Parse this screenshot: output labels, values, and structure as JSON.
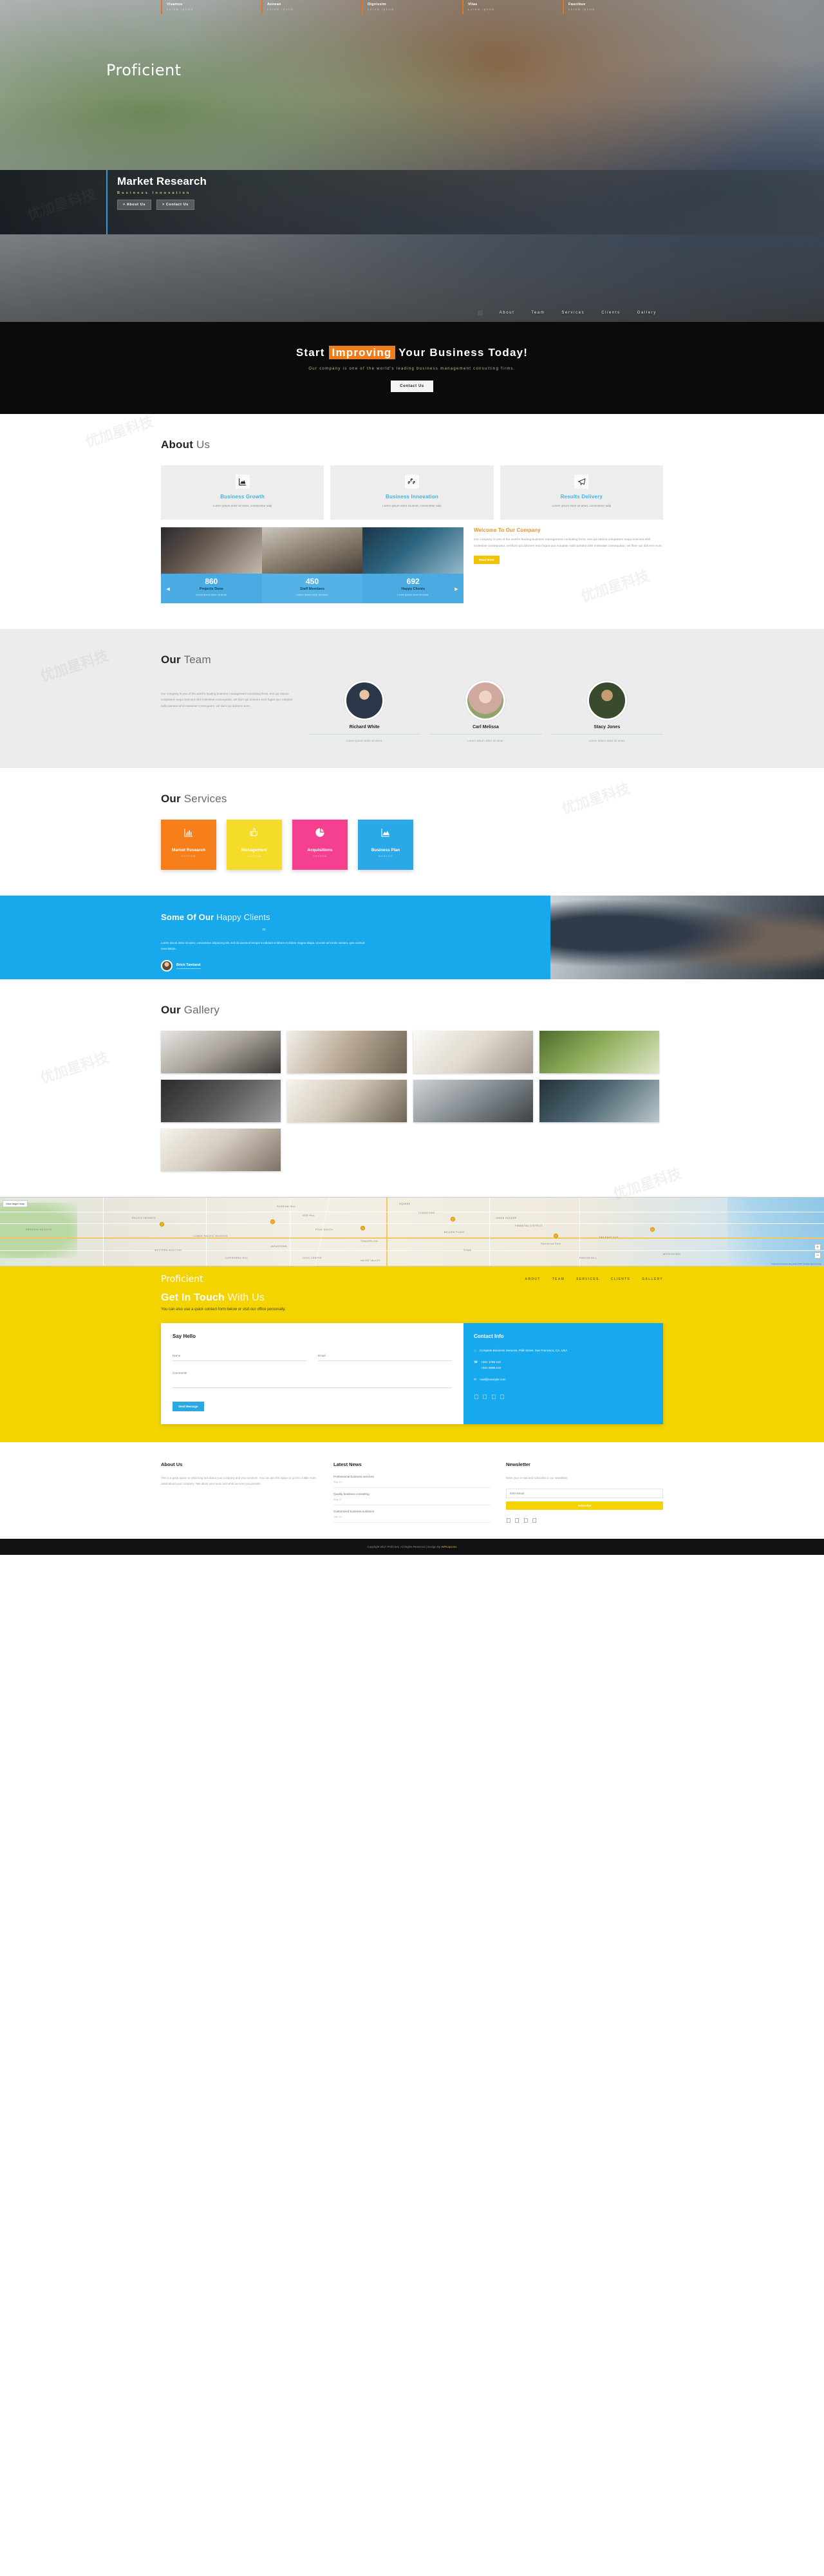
{
  "topbar": {
    "items": [
      {
        "title": "Vivamus",
        "sub": "Lorem ipsum"
      },
      {
        "title": "Aenean",
        "sub": "Lorem ipsum"
      },
      {
        "title": "Dignissim",
        "sub": "Lorem ipsum"
      },
      {
        "title": "Vitae",
        "sub": "Lorem ipsum"
      },
      {
        "title": "Faucibus",
        "sub": "Lorem ipsum"
      }
    ]
  },
  "brand": {
    "name": "Proficient"
  },
  "hero": {
    "title": "Market Research",
    "subtitle": "Business Innovation",
    "btn_about": "> About Us",
    "btn_contact": "> Contact Us"
  },
  "menu": {
    "items": [
      "About",
      "Team",
      "Services",
      "Clients",
      "Gallery"
    ]
  },
  "cta": {
    "title_a": "Start",
    "title_hl": "Improving",
    "title_b": "Your Business Today!",
    "desc": "Our company is one of the world's leading business management consulting firms.",
    "button": "Contact Us"
  },
  "about": {
    "title_b": "About",
    "title_s": "Us",
    "features": [
      {
        "icon": "chart-area-icon",
        "glyph": "◢",
        "title": "Business Growth",
        "text": "Lorem ipsum dolor sit amet, consectetur adip"
      },
      {
        "icon": "cubes-icon",
        "glyph": "❖",
        "title": "Business Innovation",
        "text": "Lorem ipsum dolor sit amet, consectetur adip"
      },
      {
        "icon": "paper-plane-icon",
        "glyph": "➤",
        "title": "Results Delivery",
        "text": "Lorem ipsum dolor sit amet, consectetur adip"
      }
    ],
    "counters": [
      {
        "number": "860",
        "label": "Projects Done",
        "desc": "Lorem ipsum dolor sit amet."
      },
      {
        "number": "450",
        "label": "Staff Members",
        "desc": "Lorem ipsum dolor sit amet."
      },
      {
        "number": "692",
        "label": "Happy Clients",
        "desc": "Lorem ipsum dolor sit amet."
      }
    ],
    "welcome_title": "Welcome To Our Company",
    "welcome_text": "Our company is one of the world's leading business management consulting firms. eos qui ratione voluptatem sequi nesciunt.nihil molestiae consequatur, vel illum qui dolorem eum fugiat quo voluptas nulla pariatur.nihil molestiae consequatur, vel illum qui dolorem eum.",
    "read_more": "Read More"
  },
  "team": {
    "title_b": "Our",
    "title_s": "Team",
    "copy": "Our company is one of the world's leading business management consulting firms. eos qui ratione voluptatem sequi nesciunt.nihil molestiae consequatur, vel illum qui dolorem eum fugiat quo voluptas nulla pariatur.nihil molestiae consequatur, vel illum qui dolorem eum.",
    "members": [
      {
        "name": "Richard White",
        "role": "Lorem ipsum dolor sit amet."
      },
      {
        "name": "Carl Melissa",
        "role": "Lorem ipsum dolor sit amet."
      },
      {
        "name": "Stacy Jones",
        "role": "Lorem ipsum dolor sit amet."
      }
    ]
  },
  "services": {
    "title_b": "Our",
    "title_s": "Services",
    "items": [
      {
        "title": "Market Research",
        "sub": "CUSTOM",
        "color": "#f77f1b",
        "icon": "bar-chart-icon",
        "glyph": "█"
      },
      {
        "title": "Management",
        "sub": "CUSTOM",
        "color": "#f5dc28",
        "icon": "thumbs-up-icon",
        "glyph": "ὄd"
      },
      {
        "title": "Acquisitions",
        "sub": "CUSTOM",
        "color": "#f4408f",
        "icon": "pie-chart-icon",
        "glyph": "◕"
      },
      {
        "title": "Business Plan",
        "sub": "MARKUP",
        "color": "#2ba8e8",
        "icon": "chart-area-icon",
        "glyph": "◢"
      }
    ]
  },
  "clients": {
    "title_b": "Some Of Our",
    "title_s": "Happy Clients",
    "quote_mark": "”",
    "text": "Lorem ipsum dolor sit amet, consectetur adipiscing elit, sed do eiusmod tempor incididunt ut labore et dolore magna aliqua. Ut enim ad minim veniam, quis nostrud exercitation.",
    "author": "Brick Tamland"
  },
  "gallery": {
    "title_b": "Our",
    "title_s": "Gallery",
    "items": [
      "gallery-1",
      "gallery-2",
      "gallery-3",
      "gallery-4",
      "gallery-5",
      "gallery-6",
      "gallery-7",
      "gallery-8",
      "gallery-9"
    ]
  },
  "map": {
    "toolbar": "View larger map",
    "zoom_in": "+",
    "zoom_out": "−",
    "footer": "Keyboard shortcuts   Map data ©2017   Google   Terms of Use",
    "labels": [
      "PACIFIC HEIGHTS",
      "NOB HILL",
      "CHINATOWN",
      "RUSSIAN HILL",
      "POLK GULCH",
      "FINANCIAL DISTRICT",
      "PRESIDIO HEIGHTS",
      "LOWER PACIFIC HEIGHTS",
      "TENDERLOIN",
      "SOMA",
      "JAPANTOWN",
      "THE EAST CUT",
      "BELDEN PLACE",
      "SQUARE",
      "WESTERN ADDITION",
      "CIVIC CENTER",
      "MISSION BAY",
      "HAYES VALLEY",
      "Salesforce Park",
      "UNION SQUARE",
      "RINCON HILL",
      "CATHEDRAL HILL"
    ]
  },
  "contact": {
    "logo": "Proficient",
    "nav": [
      "ABOUT",
      "TEAM",
      "SERVICES",
      "CLIENTS",
      "GALLERY"
    ],
    "title_b": "Get In Touch",
    "title_s": "With Us",
    "desc": "You can also use a quick contact form below or visit our office personally.",
    "form_title": "Say Hello",
    "name_placeholder": "Name",
    "email_placeholder": "Email",
    "message_placeholder": "Comments",
    "send_label": "Send Message",
    "info_title": "Contact Info",
    "address": "Complete Business Services, Polk Street, San Francisco, CA, USA",
    "phone1": "+001 1786 610",
    "phone2": "+001 5698 615",
    "email": "mail@example.com",
    "socials": [
      "facebook-icon",
      "twitter-icon",
      "google-plus-icon",
      "linkedin-icon"
    ]
  },
  "footer": {
    "about_title": "About Us",
    "about_text": "This is a great space to write long text about your company and your services. You can use this space to go into a little more detail about your company. Talk about your team and what services you provide.",
    "news_title": "Latest News",
    "news": [
      {
        "title": "Professional business services",
        "date": "Sep 12"
      },
      {
        "title": "Quality business consulting",
        "date": "Aug 20"
      },
      {
        "title": "Customized business solutions",
        "date": "July 29"
      }
    ],
    "nl_title": "Newsletter",
    "nl_text": "Enter your e-mail and subscribe to our newsletter.",
    "nl_placeholder": "Enter Email",
    "nl_button": "Subscribe",
    "socials": [
      "facebook-icon",
      "twitter-icon",
      "google-plus-icon",
      "linkedin-icon"
    ]
  },
  "copyright": {
    "text": "Copyright 2017 Proficient. All Rights Reserved | Design By ",
    "link": "WPKapsons"
  },
  "watermarks": [
    "优加星科技",
    "优加星科技",
    "优加星科技",
    "优加星科技",
    "优加星科技",
    "优加星科技",
    "优加星科技",
    "优加星科技"
  ],
  "colors": {
    "orange": "#f07d1a",
    "blue": "#18a8ec",
    "yellow": "#f3d400",
    "pink": "#f4408f",
    "dark": "#0b0b0c"
  }
}
